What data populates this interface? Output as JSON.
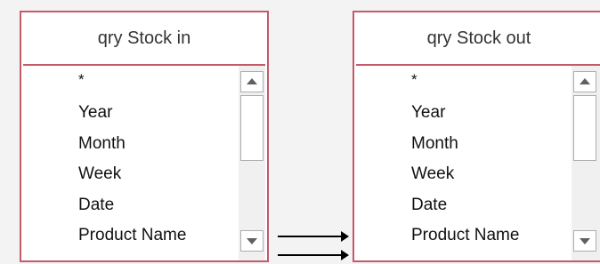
{
  "tables": [
    {
      "title": "qry Stock in",
      "fields": [
        "*",
        "Year",
        "Month",
        "Week",
        "Date",
        "Product Name"
      ]
    },
    {
      "title": "qry Stock out",
      "fields": [
        "*",
        "Year",
        "Month",
        "Week",
        "Date",
        "Product Name"
      ]
    }
  ],
  "colors": {
    "border": "#c55a68",
    "background": "#f3f3f3",
    "join_line": "#000000"
  },
  "icons": {
    "scroll_up": "triangle-up-icon",
    "scroll_down": "triangle-down-icon",
    "join_arrow": "arrow-right-icon"
  }
}
